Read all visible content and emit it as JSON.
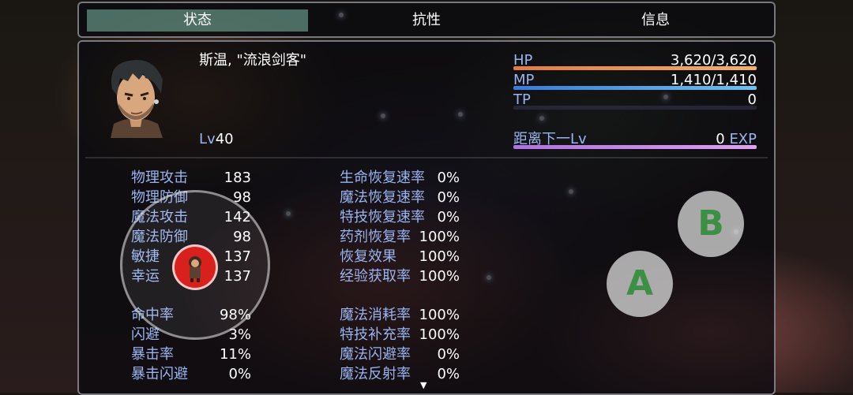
{
  "tabs": [
    {
      "label": "状态",
      "active": true
    },
    {
      "label": "抗性",
      "active": false
    },
    {
      "label": "信息",
      "active": false
    }
  ],
  "actor": {
    "name_title": "斯温, \"流浪剑客\"",
    "level_label": "Lv",
    "level": "40"
  },
  "gauges": {
    "hp": {
      "label": "HP",
      "value": "3,620/3,620",
      "fill": 1.0,
      "color_a": "#e07a4a",
      "color_b": "#f0b070"
    },
    "mp": {
      "label": "MP",
      "value": "1,410/1,410",
      "fill": 1.0,
      "color_a": "#3a7ad8",
      "color_b": "#70c0f0"
    },
    "tp": {
      "label": "TP",
      "value": "0",
      "fill": 0.0,
      "color_a": "#3a9a4a",
      "color_b": "#80d080"
    },
    "exp": {
      "label": "距离下一Lv",
      "value": "0",
      "unit": "EXP",
      "fill": 1.0,
      "color_a": "#b070e0",
      "color_b": "#e0a0f0"
    }
  },
  "params_left": [
    {
      "label": "物理攻击",
      "value": "183"
    },
    {
      "label": "物理防御",
      "value": "98"
    },
    {
      "label": "魔法攻击",
      "value": "142"
    },
    {
      "label": "魔法防御",
      "value": "98"
    },
    {
      "label": "敏捷",
      "value": "137"
    },
    {
      "label": "幸运",
      "value": "137"
    }
  ],
  "params_mid": [
    {
      "label": "生命恢复速率",
      "value": "0%"
    },
    {
      "label": "魔法恢复速率",
      "value": "0%"
    },
    {
      "label": "特技恢复速率",
      "value": "0%"
    },
    {
      "label": "药剂恢复率",
      "value": "100%"
    },
    {
      "label": "恢复效果",
      "value": "100%"
    },
    {
      "label": "经验获取率",
      "value": "100%"
    }
  ],
  "params_left2": [
    {
      "label": "命中率",
      "value": "98%"
    },
    {
      "label": "闪避",
      "value": "3%"
    },
    {
      "label": "暴击率",
      "value": "11%"
    },
    {
      "label": "暴击闪避",
      "value": "0%"
    }
  ],
  "params_mid2": [
    {
      "label": "魔法消耗率",
      "value": "100%"
    },
    {
      "label": "特技补充率",
      "value": "100%"
    },
    {
      "label": "魔法闪避率",
      "value": "0%"
    },
    {
      "label": "魔法反射率",
      "value": "0%"
    }
  ],
  "virtual_buttons": {
    "a": "A",
    "b": "B"
  },
  "scroll_indicator": "▼"
}
